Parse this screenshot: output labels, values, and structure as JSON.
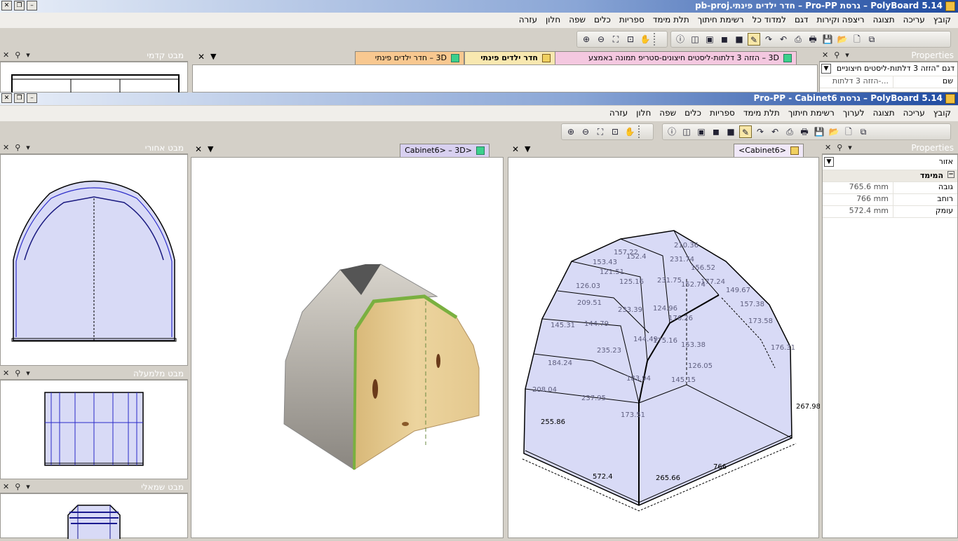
{
  "back_window": {
    "title": "PolyBoard 5.14 – גרסת Pro-PP – חדר ילדים פינתי.pb-proj",
    "menu": [
      "קובץ",
      "עריכה",
      "תצוגה",
      "ריצפה וקירות",
      "דגם",
      "למדוד כל",
      "רשימת חיתוך",
      "תלת מימד",
      "ספריות",
      "כלים",
      "שפה",
      "חלון",
      "עזרה"
    ],
    "tabs": [
      "3D – הזזה 3 דלתות-ליסטים חיצונים-סטריפ תמונה באמצע",
      "חדר ילדים פינתי",
      "3D – חדר ילדים פינתי"
    ],
    "left_panel_title": "מבט קדמי",
    "properties_title": "Properties",
    "selector_value": "דגם \"הזזה 3 דלתות-ליסטים חיצוניים",
    "name_label": "שם",
    "name_value": "הזזה 3 דלתות-..."
  },
  "front_window": {
    "title": "PolyBoard 5.14 – גרסת Pro-PP - Cabinet6",
    "menu": [
      "קובץ",
      "עריכה",
      "תצוגה",
      "לערוך",
      "רשימת חיתוך",
      "תלת מימד",
      "ספריות",
      "כלים",
      "שפה",
      "חלון",
      "עזרה"
    ],
    "left_panels": [
      "מבט אחורי",
      "מבט מלמעלה",
      "מבט שמאלי"
    ],
    "tab_3d": "<Cabinet6> – 3D",
    "tab_plan": "<Cabinet6>",
    "properties_title": "Properties",
    "selector_value": "אזור",
    "section_title": "המימד",
    "props": [
      {
        "name": "גובה",
        "value": "765.6 mm"
      },
      {
        "name": "רוחב",
        "value": "766 mm"
      },
      {
        "name": "עומק",
        "value": "572.4 mm"
      }
    ],
    "dimensions": [
      "157.22",
      "210.36",
      "153.43",
      "152.4",
      "231.74",
      "121.51",
      "156.52",
      "126.03",
      "125.16",
      "231.75",
      "152.74",
      "177.24",
      "209.51",
      "149.67",
      "145.31",
      "144.79",
      "233.39",
      "124.96",
      "176.26",
      "157.38",
      "173.58",
      "144.49",
      "175.16",
      "153.38",
      "176.31",
      "184.24",
      "235.23",
      "126.05",
      "183.94",
      "145.15",
      "208.04",
      "237.95",
      "173.51",
      "255.86",
      "267.98",
      "572.4",
      "265.66",
      "766"
    ]
  },
  "colors": {
    "title_dark": "#1e4aa0",
    "panel_tint": "#d8daf6",
    "tab_pink": "#f4c8e0",
    "tab_orange": "#f8c890",
    "tab_lilac": "#d8d0f0"
  }
}
